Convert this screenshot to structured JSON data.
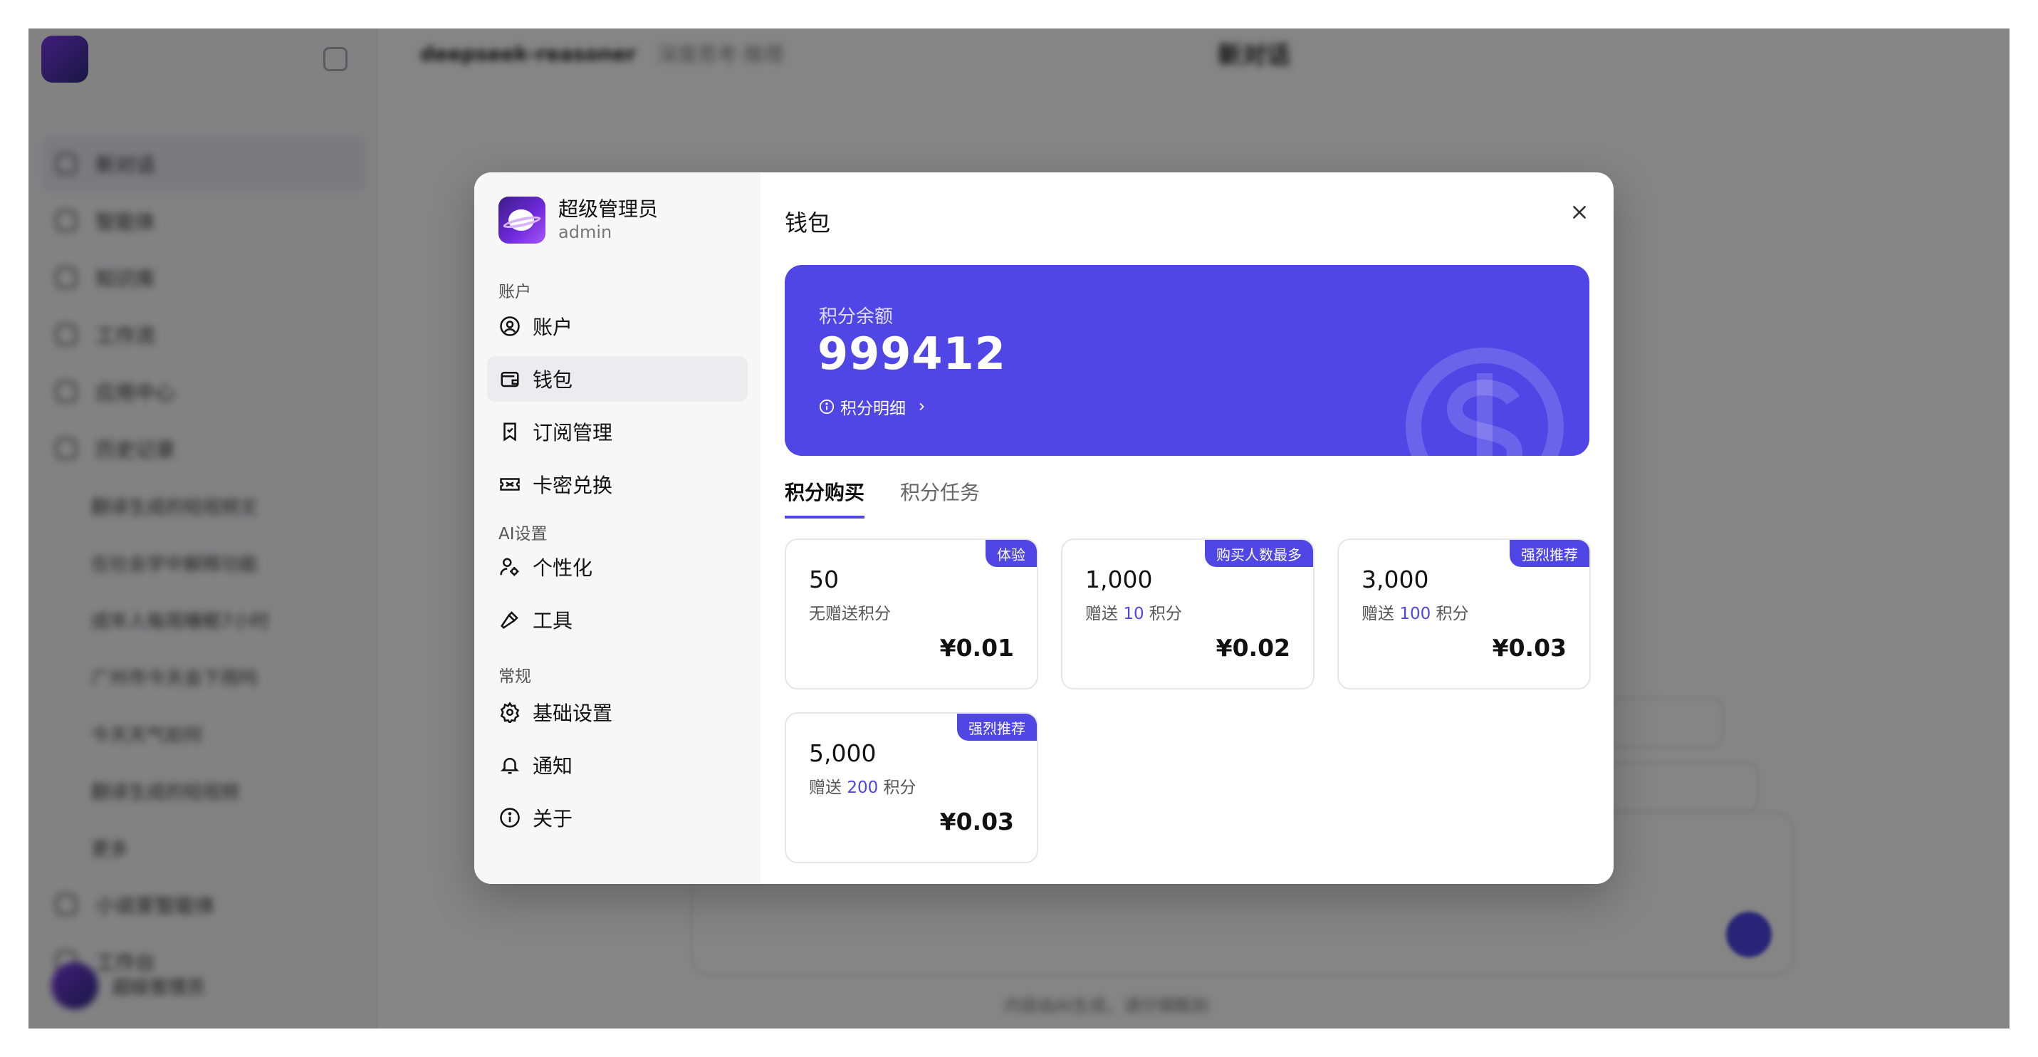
{
  "background_app": {
    "model_name": "deepseek-reasoner",
    "model_tag": "深度思考·推理",
    "page_title": "新对话",
    "nav": [
      "新对话",
      "智能体",
      "知识库",
      "工作流",
      "应用中心",
      "历史记录"
    ],
    "history": [
      "翻译生成的短视频文",
      "在社会学中解释功能",
      "成年人每周睡眠7小时",
      "广州市今天会下雨吗",
      "今天天气如何",
      "翻译生成的短视频",
      "更多"
    ],
    "bottom_nav": [
      "小说家智能体",
      "工作台"
    ],
    "user_name": "超级管理员",
    "footer": "内容由AI生成，请仔细甄别"
  },
  "modal": {
    "user": {
      "name": "超级管理员",
      "role": "admin"
    },
    "sections": {
      "account": "账户",
      "ai": "AI设置",
      "general": "常规"
    },
    "menu": {
      "account": "账户",
      "wallet": "钱包",
      "subscription": "订阅管理",
      "card_redeem": "卡密兑换",
      "personalize": "个性化",
      "tools": "工具",
      "basic_settings": "基础设置",
      "notifications": "通知",
      "about": "关于"
    },
    "title": "钱包",
    "balance": {
      "label": "积分余额",
      "value": "999412",
      "detail_link": "积分明细"
    },
    "tabs": {
      "purchase": "积分购买",
      "tasks": "积分任务"
    },
    "packages": [
      {
        "badge": "体验",
        "amount": "50",
        "bonus_prefix": "无赠送积分",
        "bonus_value": "",
        "bonus_suffix": "",
        "price": "¥0.01"
      },
      {
        "badge": "购买人数最多",
        "amount": "1,000",
        "bonus_prefix": "赠送 ",
        "bonus_value": "10",
        "bonus_suffix": " 积分",
        "price": "¥0.02"
      },
      {
        "badge": "强烈推荐",
        "amount": "3,000",
        "bonus_prefix": "赠送 ",
        "bonus_value": "100",
        "bonus_suffix": " 积分",
        "price": "¥0.03"
      },
      {
        "badge": "强烈推荐",
        "amount": "5,000",
        "bonus_prefix": "赠送 ",
        "bonus_value": "200",
        "bonus_suffix": " 积分",
        "price": "¥0.03"
      }
    ]
  },
  "colors": {
    "accent": "#4f46e5",
    "overlay": "rgba(0,0,0,0.48)",
    "modal_sidebar": "#f7f7f8"
  }
}
